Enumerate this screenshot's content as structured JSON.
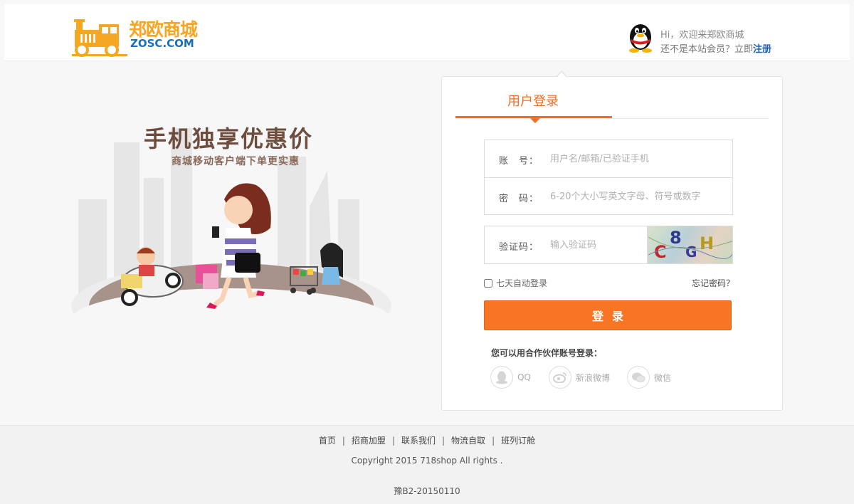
{
  "header": {
    "logo_text": "郑欧商城",
    "logo_sub": "ZOSC.COM",
    "greeting": "Hi，欢迎来郑欧商城",
    "not_member": "还不是本站会员？立即",
    "register_link": "注册"
  },
  "promo": {
    "title": "手机独享优惠价",
    "subtitle": "商城移动客户端下单更实惠"
  },
  "login": {
    "tab_label": "用户登录",
    "account_label": "账　号：",
    "account_placeholder": "用户名/邮箱/已验证手机",
    "password_label": "密　码：",
    "password_placeholder": "6-20个大小写英文字母、符号或数字",
    "captcha_label": "验证码：",
    "captcha_placeholder": "输入验证码",
    "captcha_chars": [
      "C",
      "8",
      "G",
      "H"
    ],
    "remember_label": "七天自动登录",
    "forgot_label": "忘记密码？",
    "submit_label": "登录",
    "partner_title": "您可以用合作伙伴账号登录：",
    "partners": [
      {
        "label": "QQ",
        "icon": "qq-icon"
      },
      {
        "label": "新浪微博",
        "icon": "weibo-icon"
      },
      {
        "label": "微信",
        "icon": "wechat-icon"
      }
    ]
  },
  "footer": {
    "links": [
      "首页",
      "招商加盟",
      "联系我们",
      "物流自取",
      "班列订舱"
    ],
    "copyright": "Copyright 2015 718shop All rights .",
    "icp": "豫B2-20150110"
  },
  "colors": {
    "accent": "#f87623",
    "tab_accent": "#f26f21",
    "link": "#1a5fb4",
    "logo_orange": "#f5a623",
    "logo_blue": "#1a6fb8"
  }
}
